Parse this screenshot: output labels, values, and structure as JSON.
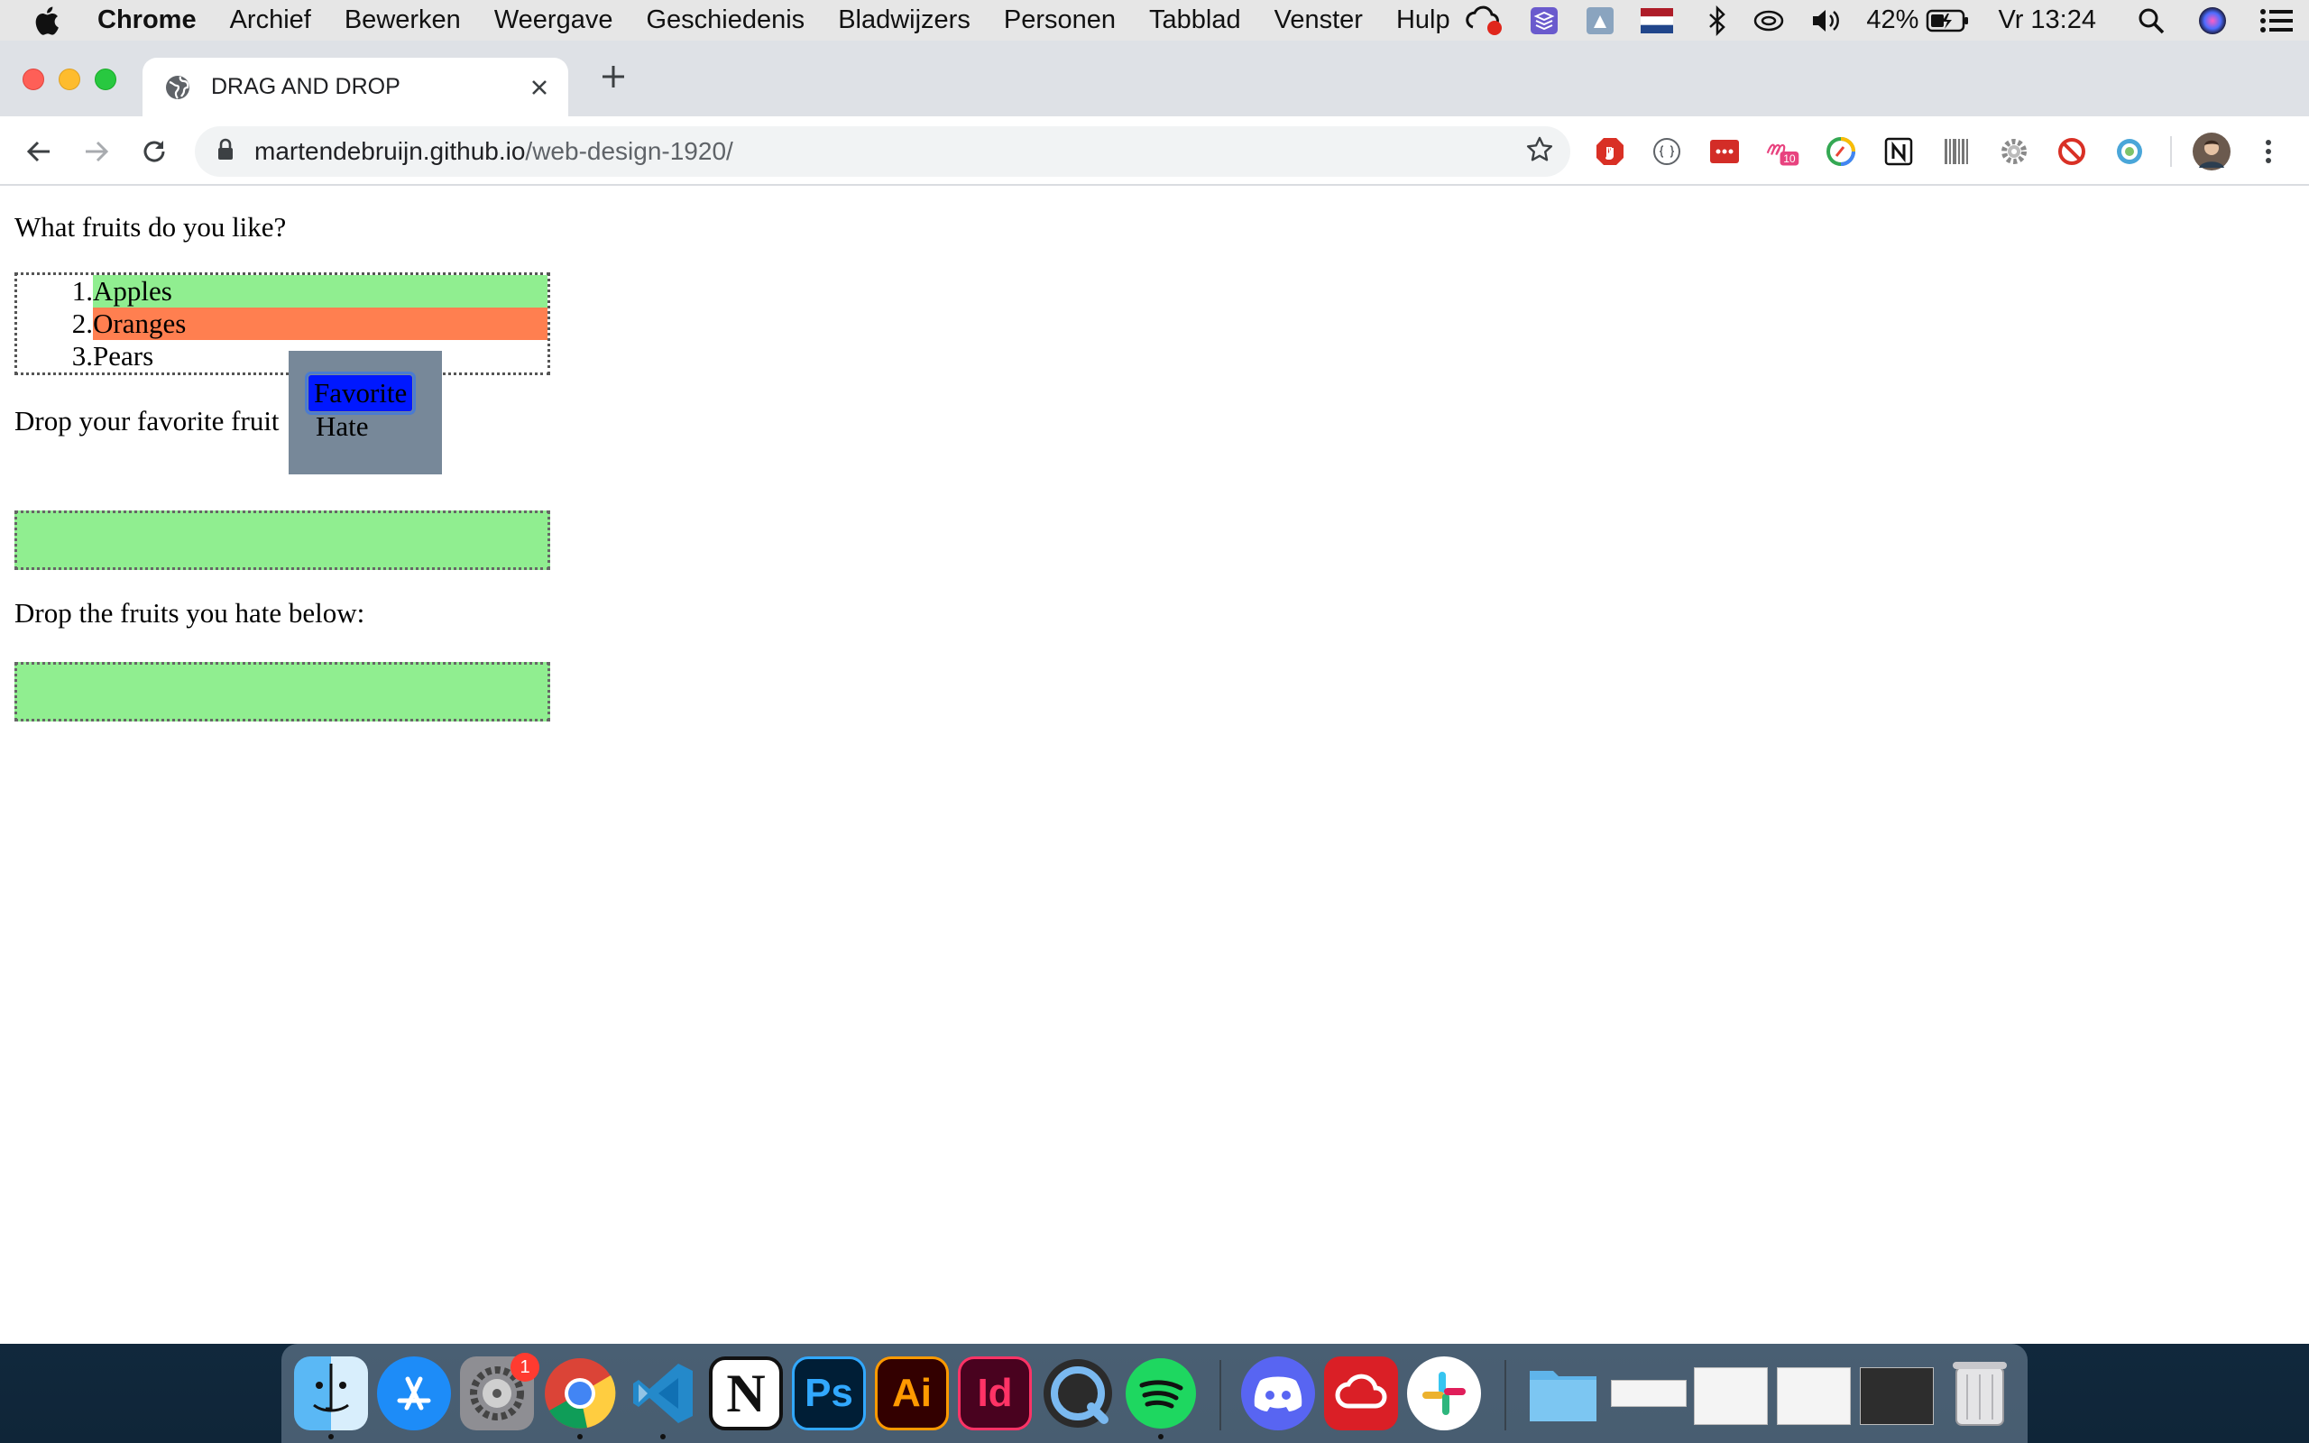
{
  "menubar": {
    "app_name": "Chrome",
    "items": [
      "Archief",
      "Bewerken",
      "Weergave",
      "Geschiedenis",
      "Bladwijzers",
      "Personen",
      "Tabblad",
      "Venster",
      "Hulp"
    ],
    "battery": "42%",
    "clock": "Vr 13:24"
  },
  "browser": {
    "tab_title": "DRAG AND DROP",
    "url_host": "martendebruijn.github.io",
    "url_path": "/web-design-1920/",
    "extension_badge": "10"
  },
  "page": {
    "question": "What fruits do you like?",
    "fruits": [
      {
        "num": "1.",
        "name": "Apples"
      },
      {
        "num": "2.",
        "name": "Oranges"
      },
      {
        "num": "3.",
        "name": "Pears"
      }
    ],
    "context_menu": {
      "favorite": "Favorite",
      "hate": "Hate"
    },
    "drop_favorite_label": "Drop your favorite fruit",
    "drop_hate_label": "Drop the fruits you hate below:"
  },
  "colors": {
    "apples_bg": "#90ee90",
    "oranges_bg": "#ff7f50",
    "drop_zone_bg": "#90ee90",
    "context_menu_bg": "#778899",
    "selected_option_bg": "#0018ff"
  },
  "dock": {
    "apps": [
      "finder",
      "app-store",
      "system-preferences",
      "chrome",
      "vscode",
      "notion",
      "photoshop",
      "illustrator",
      "indesign",
      "quicktime",
      "spotify",
      "discord",
      "creative-cloud",
      "slack"
    ],
    "labels": {
      "photoshop": "Ps",
      "illustrator": "Ai",
      "indesign": "Id",
      "notion": "N"
    },
    "system_preferences_badge": "1"
  }
}
